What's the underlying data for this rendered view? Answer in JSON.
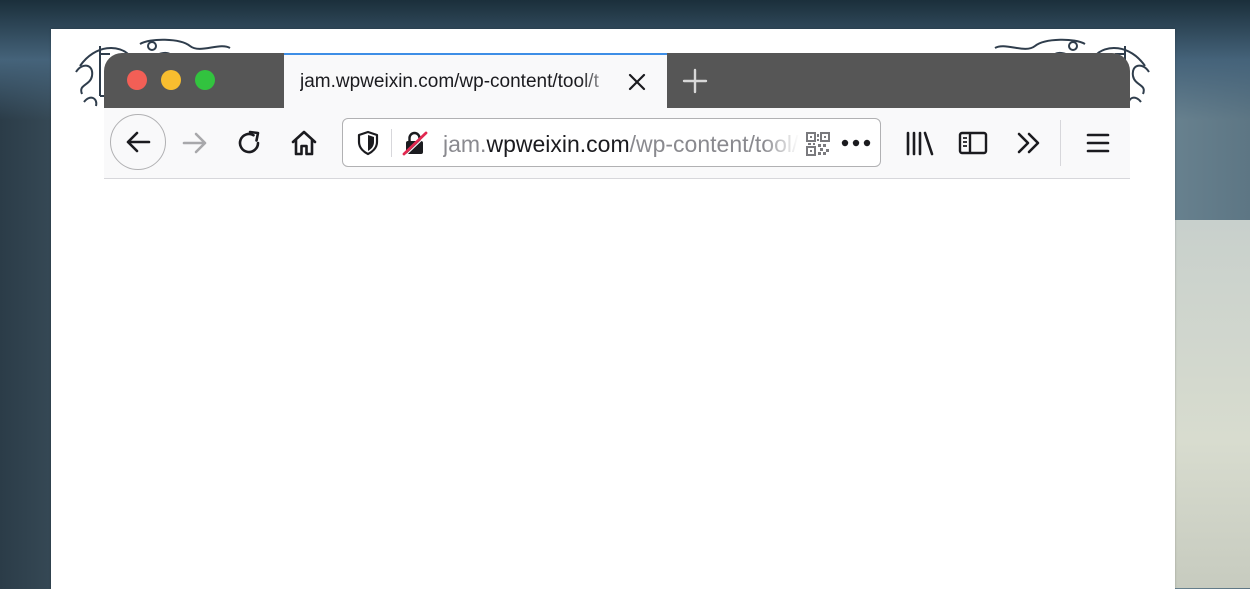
{
  "tab": {
    "title": "jam.wpweixin.com/wp-content/tool/t",
    "close_icon": "close-icon"
  },
  "url": {
    "prefix": "jam.",
    "domain": "wpweixin.com",
    "path": "/wp-content/tool/"
  },
  "icons": {
    "back": "back-arrow-icon",
    "forward": "forward-arrow-icon",
    "reload": "reload-icon",
    "home": "home-icon",
    "tracking_protection": "shield-icon",
    "connection": "insecure-lock-icon",
    "qr": "qr-code-icon",
    "page_actions": "more-horizontal-icon",
    "library": "library-icon",
    "sidebar": "sidebar-icon",
    "overflow": "chevron-double-right-icon",
    "menu": "hamburger-menu-icon",
    "new_tab": "plus-icon"
  },
  "colors": {
    "tab_strip": "#565656",
    "toolbar": "#f9f9fa",
    "active_tab_accent": "#3e8ee6",
    "close_dot": "#f25f56",
    "minimize_dot": "#f8be2f",
    "zoom_dot": "#32c33f"
  }
}
